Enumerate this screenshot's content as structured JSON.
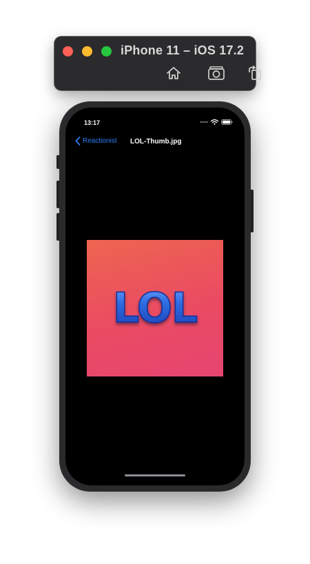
{
  "simulator": {
    "title": "iPhone 11 – iOS 17.2",
    "toolbar": {
      "home_icon": "home-icon",
      "screenshot_icon": "camera-icon",
      "rotate_icon": "rotate-icon"
    }
  },
  "status_bar": {
    "time": "13:17",
    "icons": [
      "cellular-dots-icon",
      "wifi-icon",
      "battery-icon"
    ]
  },
  "nav_bar": {
    "back_label": "Reactionist",
    "title": "LOL-Thumb.jpg"
  },
  "image": {
    "text": "LOL",
    "colors": {
      "background_top": "#ee6550",
      "background_bottom": "#e64570",
      "text_fill": "#2d6be0"
    }
  },
  "colors": {
    "accent": "#2f7ff7",
    "screen_background": "#000000"
  }
}
